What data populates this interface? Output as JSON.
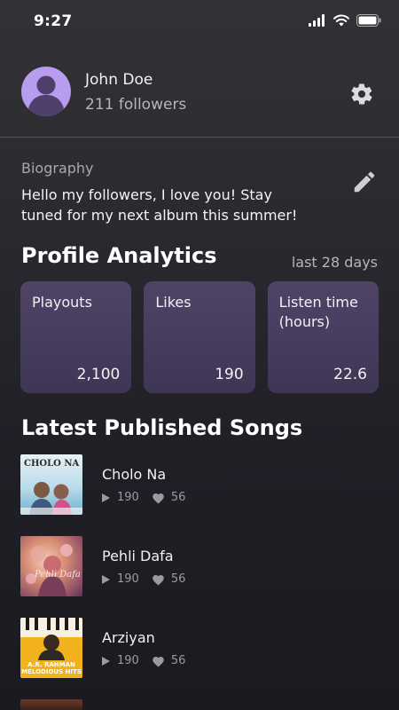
{
  "status_bar": {
    "time": "9:27"
  },
  "profile": {
    "name": "John Doe",
    "followers": "211 followers"
  },
  "bio": {
    "label": "Biography",
    "text": "Hello my followers, I love you! Stay tuned for my next album this summer!"
  },
  "analytics": {
    "title": "Profile Analytics",
    "range": "last 28 days",
    "cards": [
      {
        "label": "Playouts",
        "value": "2,100"
      },
      {
        "label": "Likes",
        "value": "190"
      },
      {
        "label": "Listen time (hours)",
        "value": "22.6"
      }
    ]
  },
  "songs": {
    "title": "Latest Published Songs",
    "items": [
      {
        "title": "Cholo Na",
        "plays": "190",
        "likes": "56",
        "cover_text": "CHOLO NA"
      },
      {
        "title": "Pehli Dafa",
        "plays": "190",
        "likes": "56",
        "cover_text": "Pehli Dafa"
      },
      {
        "title": "Arziyan",
        "plays": "190",
        "likes": "56",
        "cover_text": "A.R. RAHMAN MELODIOUS HITS"
      }
    ]
  },
  "colors": {
    "accent": "#b79cf0",
    "card": "#4a405f",
    "background": "#2a2a30"
  }
}
